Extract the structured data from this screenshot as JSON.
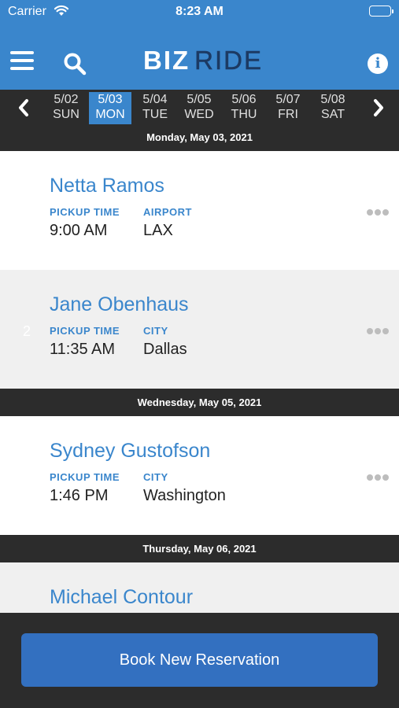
{
  "status_bar": {
    "carrier": "Carrier",
    "time": "8:23 AM"
  },
  "nav": {
    "logo_left": "BIZ",
    "logo_right": "RIDE",
    "icons": {
      "menu": "hamburger-menu-icon",
      "search": "search-icon",
      "info": "info-icon"
    },
    "info_glyph": "i"
  },
  "date_strip": {
    "days": [
      {
        "date": "5/02",
        "weekday": "SUN"
      },
      {
        "date": "5/03",
        "weekday": "MON"
      },
      {
        "date": "5/04",
        "weekday": "TUE"
      },
      {
        "date": "5/05",
        "weekday": "WED"
      },
      {
        "date": "5/06",
        "weekday": "THU"
      },
      {
        "date": "5/07",
        "weekday": "FRI"
      },
      {
        "date": "5/08",
        "weekday": "SAT"
      }
    ],
    "selected": "5/03"
  },
  "sections": [
    {
      "header": "Monday, May 03, 2021"
    },
    {
      "header": "Wednesday, May 05, 2021"
    },
    {
      "header": "Thursday, May 06, 2021"
    }
  ],
  "reservations": [
    {
      "name": "Netta Ramos",
      "time_label": "PICKUP TIME",
      "time": "9:00 AM",
      "loc_label": "AIRPORT",
      "loc": "LAX"
    },
    {
      "name": "Jane Obenhaus",
      "time_label": "PICKUP TIME",
      "time": "11:35 AM",
      "loc_label": "CITY",
      "loc": "Dallas",
      "index": "2"
    },
    {
      "name": "Sydney Gustofson",
      "time_label": "PICKUP TIME",
      "time": "1:46 PM",
      "loc_label": "CITY",
      "loc": "Washington"
    },
    {
      "name": "Michael Contour"
    }
  ],
  "book_button": "Book New Reservation",
  "colors": {
    "brand_blue": "#3a86cc",
    "dark_bar": "#2c2c2c",
    "logo_navy": "#1c3a63",
    "button_blue": "#3370c0"
  }
}
